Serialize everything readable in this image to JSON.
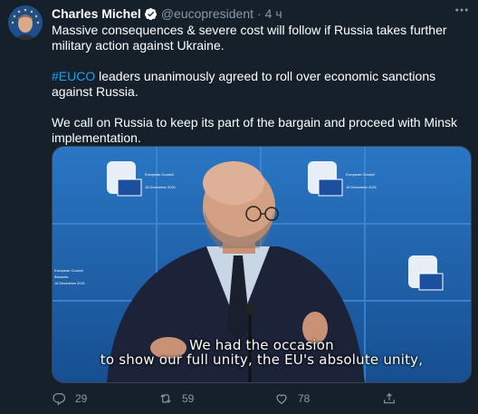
{
  "author": {
    "name": "Charles Michel",
    "handle": "@eucopresident",
    "separator": "·",
    "time": "4 ч"
  },
  "tweet": {
    "paragraph1": "Massive consequences & severe cost will follow if Russia takes further military action against Ukraine.",
    "paragraph2_hashtag": "#EUCO",
    "paragraph2_rest": " leaders unanimously agreed to roll over economic sanctions against Russia.",
    "paragraph3": "We call on Russia to keep its part of the bargain and proceed with Minsk implementation."
  },
  "media": {
    "caption_line1": "We had the occasion",
    "caption_line2": "to show our full unity, the EU's absolute unity,",
    "backdrop_text1": "European Council",
    "backdrop_text2": "Brussels",
    "backdrop_date": "16 December 2021"
  },
  "actions": {
    "replies": "29",
    "retweets": "59",
    "likes": "78"
  },
  "colors": {
    "background": "#15202b",
    "text": "#ffffff",
    "secondary": "#8899a6",
    "link": "#1da1f2",
    "backdrop": "#1f5fa8"
  }
}
